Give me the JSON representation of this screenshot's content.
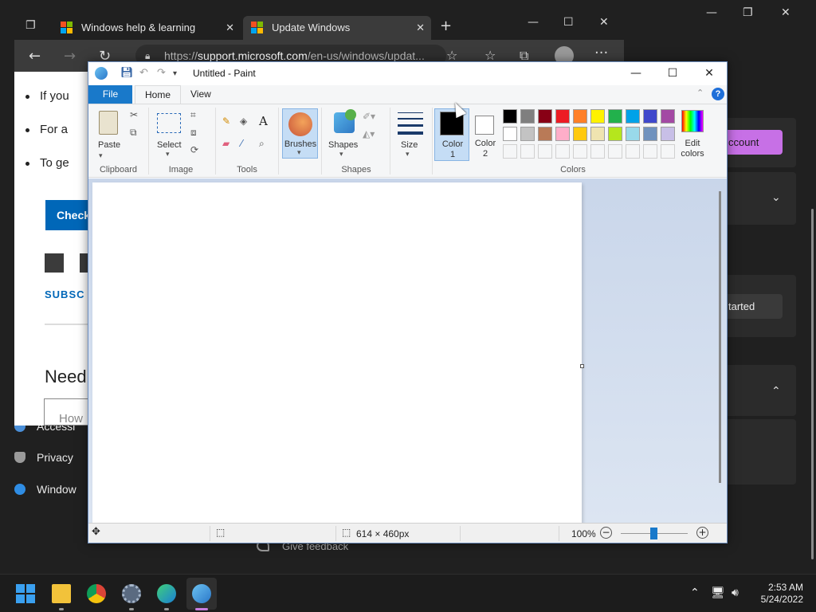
{
  "settings": {
    "account_button": "ccount",
    "started_button": "tarted",
    "nav": [
      {
        "label": "Accessi",
        "icon": "accessibility-icon"
      },
      {
        "label": "Privacy",
        "icon": "shield-icon"
      },
      {
        "label": "Window",
        "icon": "windows-update-icon"
      }
    ],
    "feedback": "Give feedback"
  },
  "edge": {
    "tabs": [
      {
        "label": "Windows help & learning"
      },
      {
        "label": "Update Windows"
      }
    ],
    "url_prefix": "https://",
    "url_host": "support.microsoft.com",
    "url_path": "/en-us/windows/updat...",
    "page": {
      "bullets": [
        "If you",
        "For a",
        "To ge"
      ],
      "check_button": "Check",
      "subscribe": "SUBSC",
      "need": "Need",
      "how_placeholder": "How"
    }
  },
  "paint": {
    "title": "Untitled - Paint",
    "tabs": {
      "file": "File",
      "home": "Home",
      "view": "View"
    },
    "groups": {
      "clipboard": "Clipboard",
      "image": "Image",
      "tools": "Tools",
      "shapes": "Shapes",
      "colors": "Colors"
    },
    "buttons": {
      "paste": "Paste",
      "select": "Select",
      "brushes": "Brushes",
      "shapes": "Shapes",
      "size": "Size",
      "color1_a": "Color",
      "color1_b": "1",
      "color2_a": "Color",
      "color2_b": "2",
      "edit_colors_a": "Edit",
      "edit_colors_b": "colors"
    },
    "color1": "#000000",
    "color2": "#ffffff",
    "palette_row1": [
      "#000000",
      "#7f7f7f",
      "#880015",
      "#ed1c24",
      "#ff7f27",
      "#fff200",
      "#22b14c",
      "#00a2e8",
      "#3f48cc",
      "#a349a4"
    ],
    "palette_row2": [
      "#ffffff",
      "#c3c3c3",
      "#b97a57",
      "#ffaec9",
      "#ffc90e",
      "#efe4b0",
      "#b5e61d",
      "#99d9ea",
      "#7092be",
      "#c8bfe7"
    ],
    "status": {
      "image_size": "614 × 460px",
      "zoom": "100%"
    }
  },
  "taskbar": {
    "time": "2:53 AM",
    "date": "5/24/2022"
  }
}
